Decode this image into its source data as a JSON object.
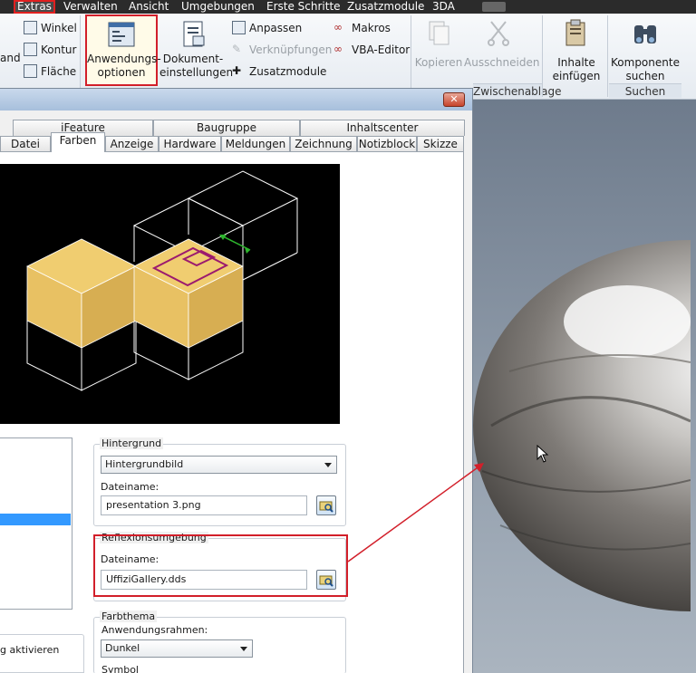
{
  "menubar": {
    "items": [
      "Extras",
      "Verwalten",
      "Ansicht",
      "Umgebungen",
      "Erste Schritte",
      "Zusatzmodule",
      "3DA"
    ],
    "active": "Extras"
  },
  "ribbon": {
    "clipped_label": "and",
    "measure": {
      "winkel": "Winkel",
      "kontur": "Kontur",
      "flaeche": "Fläche"
    },
    "optionen": {
      "anwendungsoptionen": [
        "Anwendungs-",
        "optionen"
      ],
      "dokumenteinstellungen": [
        "Dokument-",
        "einstellungen"
      ],
      "anpassen": "Anpassen",
      "verknuepfungen": "Verknüpfungen",
      "zusatzmodule": "Zusatzmodule",
      "makros": "Makros",
      "vba_editor": "VBA-Editor"
    },
    "zwischenablage": {
      "kopieren": "Kopieren",
      "ausschneiden": "Ausschneiden",
      "group": "Zwischenablage"
    },
    "inhalte": [
      "Inhalte",
      "einfügen"
    ],
    "suchen": {
      "komponente": [
        "Komponente",
        "suchen"
      ],
      "group": "Suchen"
    },
    "highlight_color": "#d21f2a"
  },
  "dialog": {
    "tabs_back": [
      "iFeature",
      "Baugruppe",
      "Inhaltscenter"
    ],
    "tabs_front": [
      "Datei",
      "Farben",
      "Anzeige",
      "Hardware",
      "Meldungen",
      "Zeichnung",
      "Notizblock",
      "Skizze"
    ],
    "selected_tab": "Farben",
    "hintergrund": {
      "title": "Hintergrund",
      "combo_value": "Hintergrundbild",
      "dateiname_label": "Dateiname:",
      "dateiname_value": "presentation 3.png"
    },
    "reflexion": {
      "title": "Reflexionsumgebung",
      "dateiname_label": "Dateiname:",
      "dateiname_value": "UffiziGallery.dds"
    },
    "farbthema": {
      "title": "Farbthema",
      "rahmen_label": "Anwendungsrahmen:",
      "rahmen_value": "Dunkel",
      "clipped_label": "Symbol"
    },
    "left_clipped_text": "g aktivieren"
  },
  "colors": {
    "part_face": "#e8c163",
    "sketch": "#9c1a6e",
    "dimension": "#2db52d",
    "arrow": "#d21f2a"
  }
}
